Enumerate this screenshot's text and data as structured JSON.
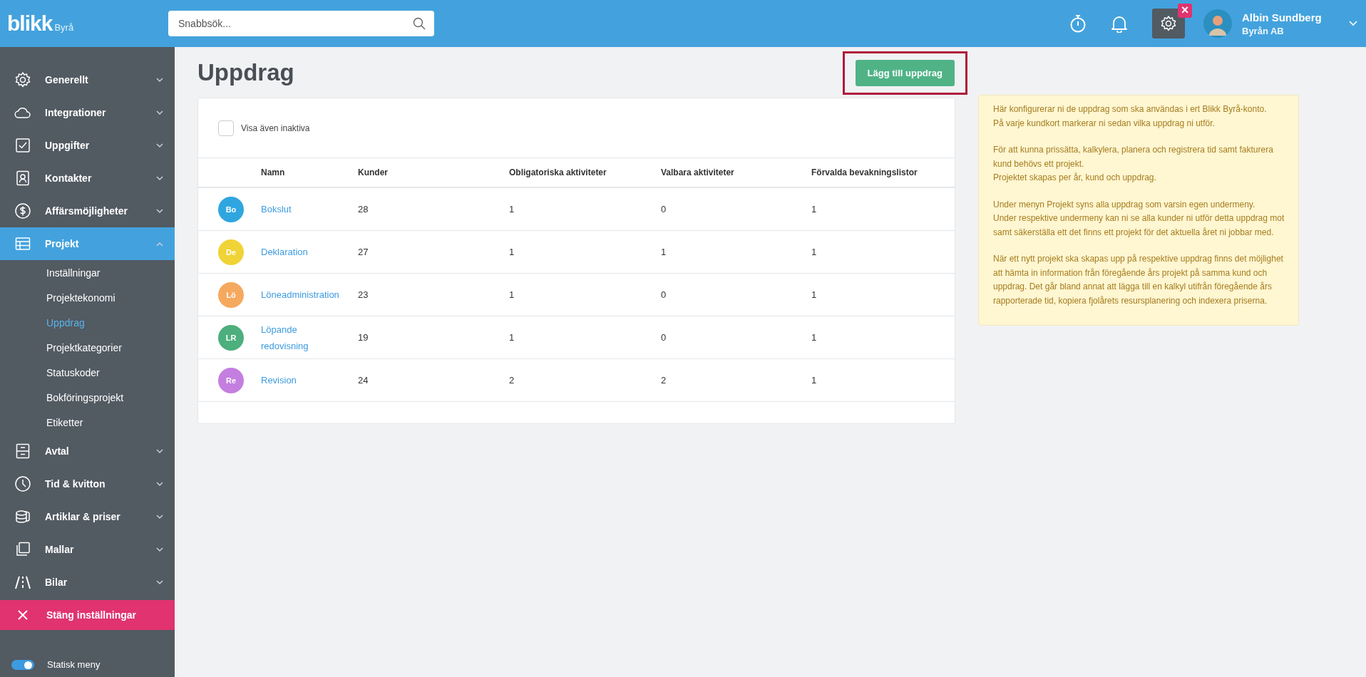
{
  "topbar": {
    "logo": "blikk",
    "logo_suffix": "Byrå",
    "search": {
      "placeholder": "Snabbsök..."
    },
    "settings_badge": "×",
    "user": {
      "name": "Albin Sundberg",
      "company": "Byrån AB"
    }
  },
  "sidebar": {
    "items": [
      {
        "label": "Generellt",
        "expanded": false,
        "selected": false
      },
      {
        "label": "Integrationer",
        "expanded": false,
        "selected": false
      },
      {
        "label": "Uppgifter",
        "expanded": false,
        "selected": false
      },
      {
        "label": "Kontakter",
        "expanded": false,
        "selected": false
      },
      {
        "label": "Affärsmöjligheter",
        "expanded": false,
        "selected": false
      },
      {
        "label": "Projekt",
        "expanded": true,
        "selected": true,
        "children": [
          {
            "label": "Inställningar",
            "selected": false
          },
          {
            "label": "Projektekonomi",
            "selected": false
          },
          {
            "label": "Uppdrag",
            "selected": true
          },
          {
            "label": "Projektkategorier",
            "selected": false
          },
          {
            "label": "Statuskoder",
            "selected": false
          },
          {
            "label": "Bokföringsprojekt",
            "selected": false
          },
          {
            "label": "Etiketter",
            "selected": false
          }
        ]
      },
      {
        "label": "Avtal",
        "expanded": false,
        "selected": false
      },
      {
        "label": "Tid & kvitton",
        "expanded": false,
        "selected": false
      },
      {
        "label": "Artiklar & priser",
        "expanded": false,
        "selected": false
      },
      {
        "label": "Mallar",
        "expanded": false,
        "selected": false
      },
      {
        "label": "Bilar",
        "expanded": false,
        "selected": false
      }
    ],
    "close_button": "Stäng inställningar",
    "static_menu": {
      "label": "Statisk meny",
      "on": true
    }
  },
  "page": {
    "title": "Uppdrag",
    "add_button": {
      "label": "Lägg till uppdrag",
      "highlighted": true
    }
  },
  "filter": {
    "label": "Visa även inaktiva",
    "checked": false
  },
  "table": {
    "columns": [
      "",
      "Namn",
      "Kunder",
      "Obligatoriska aktiviteter",
      "Valbara aktiviteter",
      "Förvalda bevakningslistor"
    ],
    "rows": [
      {
        "color": "#2fa6df",
        "cells": [
          "Bo",
          "Bokslut",
          "28",
          "1",
          "0",
          "1"
        ]
      },
      {
        "color": "#f0d336",
        "cells": [
          "De",
          "Deklaration",
          "27",
          "1",
          "1",
          "1"
        ]
      },
      {
        "color": "#f5a95e",
        "cells": [
          "Lö",
          "Löneadministration",
          "23",
          "1",
          "0",
          "1"
        ]
      },
      {
        "color": "#4caf7d",
        "cells": [
          "LR",
          "Löpande redovisning",
          "19",
          "1",
          "0",
          "1"
        ]
      },
      {
        "color": "#c47ee0",
        "cells": [
          "Re",
          "Revision",
          "24",
          "2",
          "2",
          "1"
        ]
      }
    ]
  },
  "info": {
    "paragraphs": [
      [
        "Här konfigurerar ni de uppdrag som ska användas i ert Blikk Byrå-konto.",
        "På varje kundkort markerar ni sedan vilka uppdrag ni utför."
      ],
      [
        "För att kunna prissätta, kalkylera, planera och registrera tid samt fakturera",
        "kund behövs ett projekt.",
        "Projektet skapas per år, kund och uppdrag."
      ],
      [
        "Under menyn Projekt syns alla uppdrag som varsin egen undermeny.",
        "Under respektive undermeny kan ni se alla kunder ni utför detta uppdrag mot",
        "samt säkerställa ett det finns ett projekt för det aktuella året ni jobbar med."
      ],
      [
        "När ett nytt projekt ska skapas upp på respektive uppdrag finns det möjlighet",
        "att hämta in information från föregående års projekt på samma kund och",
        "uppdrag. Det går bland annat att lägga till en kalkyl utifrån föregående års",
        "rapporterade tid, kopiera fjolårets resursplanering och indexera priserna."
      ]
    ]
  }
}
